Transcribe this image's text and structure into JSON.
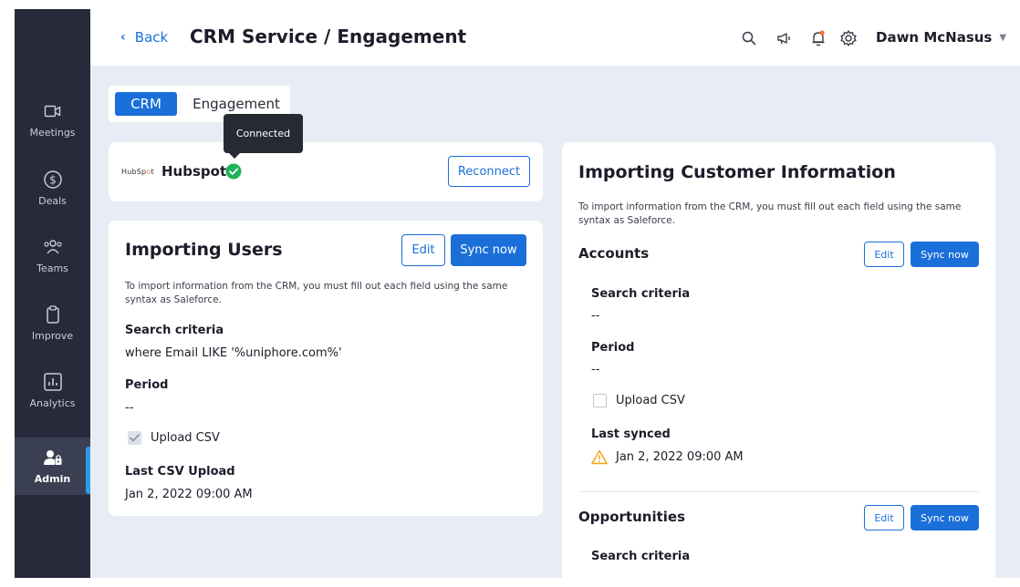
{
  "sidebar": {
    "items": [
      {
        "label": "Meetings",
        "icon": "video-icon",
        "active": false
      },
      {
        "label": "Deals",
        "icon": "dollar-icon",
        "active": false
      },
      {
        "label": "Teams",
        "icon": "teams-icon",
        "active": false
      },
      {
        "label": "Improve",
        "icon": "clipboard-icon",
        "active": false
      },
      {
        "label": "Analytics",
        "icon": "analytics-icon",
        "active": false
      },
      {
        "label": "Admin",
        "icon": "admin-icon",
        "active": true
      }
    ]
  },
  "header": {
    "back_label": "Back",
    "title": "CRM Service / Engagement",
    "icons": [
      "search-icon",
      "megaphone-icon",
      "bell-icon",
      "gear-icon"
    ],
    "user_name": "Dawn McNasus"
  },
  "tabs": [
    {
      "label": "CRM",
      "active": true
    },
    {
      "label": "Engagement",
      "active": false
    }
  ],
  "tooltip": {
    "text": "Connected"
  },
  "hubspot": {
    "logo_text_left": "HubSp",
    "logo_text_o": "o",
    "logo_text_right": "t",
    "name": "Hubspot",
    "reconnect_label": "Reconnect"
  },
  "importing_users": {
    "title": "Importing Users",
    "edit_label": "Edit",
    "sync_label": "Sync now",
    "description": "To import information from the CRM, you must fill out each field using the same syntax as Saleforce.",
    "search_criteria_label": "Search criteria",
    "search_criteria_value": "where Email LIKE '%uniphore.com%'",
    "period_label": "Period",
    "period_value": "--",
    "upload_csv_label": "Upload CSV",
    "upload_csv_checked": true,
    "last_csv_upload_label": "Last CSV Upload",
    "last_csv_upload_value": "Jan 2, 2022 09:00 AM"
  },
  "customer_info": {
    "title": "Importing Customer Information",
    "description": "To import information from the CRM, you must fill out each field using the same syntax as Saleforce.",
    "accounts": {
      "title": "Accounts",
      "edit_label": "Edit",
      "sync_label": "Sync now",
      "search_criteria_label": "Search criteria",
      "search_criteria_value": "--",
      "period_label": "Period",
      "period_value": "--",
      "upload_csv_label": "Upload CSV",
      "upload_csv_checked": false,
      "last_synced_label": "Last synced",
      "last_synced_value": "Jan 2, 2022 09:00 AM"
    },
    "opportunities": {
      "title": "Opportunities",
      "edit_label": "Edit",
      "sync_label": "Sync now",
      "search_criteria_label": "Search criteria"
    }
  },
  "colors": {
    "primary": "#1b6fd9",
    "sidebar_bg": "#262a3b",
    "page_bg": "#e8edf5",
    "success": "#1fb35a",
    "warning": "#f2a516",
    "notification": "#ff6a3d"
  }
}
